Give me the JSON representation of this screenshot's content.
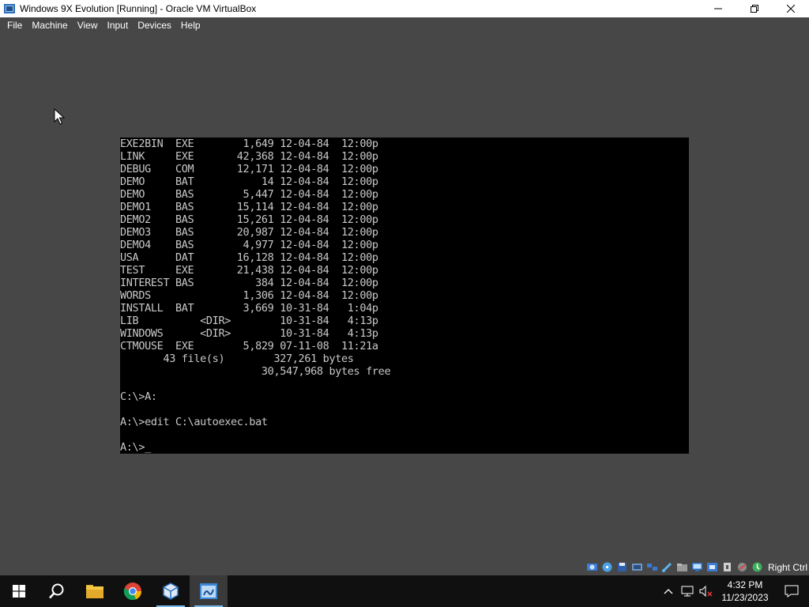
{
  "window": {
    "title": "Windows 9X Evolution [Running] - Oracle VM VirtualBox",
    "icons": [
      "virtualbox-icon",
      "minimize-icon",
      "maximize-icon",
      "close-icon"
    ]
  },
  "menu": {
    "items": [
      "File",
      "Machine",
      "View",
      "Input",
      "Devices",
      "Help"
    ]
  },
  "console": {
    "lines": [
      "EXE2BIN  EXE        1,649 12-04-84  12:00p",
      "LINK     EXE       42,368 12-04-84  12:00p",
      "DEBUG    COM       12,171 12-04-84  12:00p",
      "DEMO     BAT           14 12-04-84  12:00p",
      "DEMO     BAS        5,447 12-04-84  12:00p",
      "DEMO1    BAS       15,114 12-04-84  12:00p",
      "DEMO2    BAS       15,261 12-04-84  12:00p",
      "DEMO3    BAS       20,987 12-04-84  12:00p",
      "DEMO4    BAS        4,977 12-04-84  12:00p",
      "USA      DAT       16,128 12-04-84  12:00p",
      "TEST     EXE       21,438 12-04-84  12:00p",
      "INTEREST BAS          384 12-04-84  12:00p",
      "WORDS               1,306 12-04-84  12:00p",
      "INSTALL  BAT        3,669 10-31-84   1:04p",
      "LIB          <DIR>        10-31-84   4:13p",
      "WINDOWS      <DIR>        10-31-84   4:13p",
      "CTMOUSE  EXE        5,829 07-11-08  11:21a",
      "       43 file(s)        327,261 bytes",
      "                       30,547,968 bytes free",
      "",
      "C:\\>A:",
      "",
      "A:\\>edit C:\\autoexec.bat",
      "",
      "A:\\>"
    ],
    "cursor": "_"
  },
  "statusbar": {
    "icons": [
      "hard-disk-icon",
      "optical-drive-icon",
      "floppy-icon",
      "audio-icon",
      "network-icon",
      "usb-icon",
      "shared-folder-icon",
      "display-icon",
      "recording-icon",
      "cpu-icon",
      "mouse-integration-icon",
      "keyboard-icon"
    ],
    "host_key": "Right Ctrl"
  },
  "taskbar": {
    "apps": [
      "start-button",
      "search-icon",
      "file-explorer-icon",
      "chrome-icon",
      "virtualbox-manager-icon",
      "vm-window-icon"
    ],
    "clock_time": "4:32 PM",
    "clock_date": "11/23/2023"
  },
  "colors": {
    "desktop_bg": "#474747",
    "console_bg": "#000000",
    "console_fg": "#c8c8c8",
    "taskbar_bg": "#101010",
    "accent": "#76b9ed"
  }
}
